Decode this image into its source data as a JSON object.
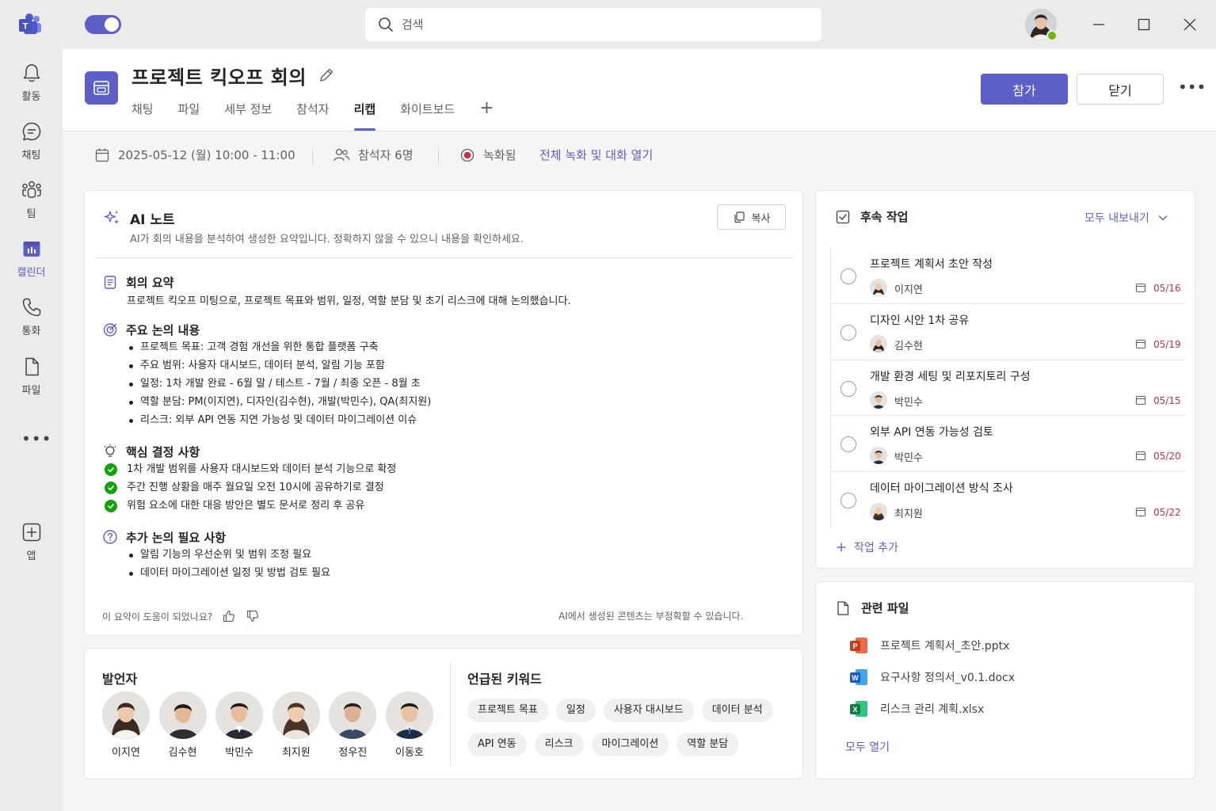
{
  "app": {
    "search_placeholder": "검색",
    "accent": "#5b5fc7"
  },
  "rail": {
    "items": [
      {
        "label": "활동",
        "icon": "bell-icon"
      },
      {
        "label": "채팅",
        "icon": "chat-icon"
      },
      {
        "label": "팀",
        "icon": "teams-icon"
      },
      {
        "label": "캘린더",
        "icon": "calendar-icon"
      },
      {
        "label": "통화",
        "icon": "phone-icon"
      },
      {
        "label": "파일",
        "icon": "file-icon"
      },
      {
        "label": "앱",
        "icon": "add-app-icon"
      }
    ],
    "more": "•••"
  },
  "header": {
    "title": "프로젝트 킥오프 회의",
    "tabs": [
      "채팅",
      "파일",
      "세부 정보",
      "참석자",
      "리캡",
      "화이트보드"
    ],
    "active_tab": "리캡",
    "tab_add": "+",
    "join_label": "참가",
    "close_label": "닫기",
    "more": "•••"
  },
  "info": {
    "datetime": "2025-05-12 (월) 10:00 - 11:00",
    "attendees": "참석자 6명",
    "recorded": "녹화됨",
    "open_link": "전체 녹화 및 대화 열기"
  },
  "ai_note": {
    "title": "AI 노트",
    "subtitle": "AI가 회의 내용을 분석하여 생성한 요약입니다.  정확하지 않을 수 있으니 내용을 확인하세요.",
    "copy_label": "복사",
    "summary_title": "회의 요약",
    "summary_text": "프로젝트 킥오프 미팅으로, 프로젝트 목표와 범위, 일정, 역할 분담 및 초기 리스크에 대해 논의했습니다.",
    "discussion_title": "주요 논의 내용",
    "discussion": [
      "프로젝트 목표: 고객 경험 개선을 위한 통합 플랫폼 구축",
      "주요 범위:  사용자 대시보드, 데이터 분석, 알림 기능 포함",
      "일정:  1차 개발 완료 - 6월 말 /  테스트 - 7월 /  최종 오픈 - 8월 초",
      "역할 분담:  PM(이지연),  디자인(김수현),  개발(박민수),  QA(최지원)",
      "리스크:  외부 API 연동 지연 가능성 및 데이터 마이그레이션 이슈"
    ],
    "decisions_title": "핵심 결정 사항",
    "decisions": [
      "1차 개발 범위를 사용자 대시보드와 데이터 분석 기능으로 확정",
      "주간 진행 상황을 매주 월요일 오전 10시에 공유하기로 결정",
      "위험 요소에 대한 대응 방안은 별도 문서로 정리 후 공유"
    ],
    "followup_title": "추가 논의 필요 사항",
    "followups": [
      "알림 기능의 우선순위 및 범위 조정 필요",
      "데이터 마이그레이션 일정 및 방법 검토 필요"
    ],
    "feedback_q": "이 요약이 도움이 되었나요?",
    "disclaimer": "AI에서 생성된 콘텐츠는 부정확할 수 있습니다."
  },
  "speakers": {
    "title": "발언자",
    "people": [
      "이지연",
      "김수현",
      "박민수",
      "최지원",
      "정우진",
      "이동호"
    ]
  },
  "keywords": {
    "title": "언급된 키워드",
    "row1": [
      "프로젝트 목표",
      "일정",
      "사용자 대시보드",
      "데이터 분석"
    ],
    "row2": [
      "API 연동",
      "리스크",
      "마이그레이션",
      "역할 분담"
    ]
  },
  "tasks": {
    "title": "후속 작업",
    "export_label": "모두 내보내기",
    "add_label": "작업 추가",
    "items": [
      {
        "name": "프로젝트 계획서 초안 작성",
        "owner": "이지연",
        "due": "05/16"
      },
      {
        "name": "디자인 시안 1차 공유",
        "owner": "김수현",
        "due": "05/19"
      },
      {
        "name": "개발 환경 세팅 및 리포지토리 구성",
        "owner": "박민수",
        "due": "05/15"
      },
      {
        "name": "외부 API 연동 가능성 검토",
        "owner": "박민수",
        "due": "05/20"
      },
      {
        "name": "데이터 마이그레이션 방식 조사",
        "owner": "최지원",
        "due": "05/22"
      }
    ]
  },
  "files": {
    "title": "관련 파일",
    "items": [
      {
        "name": "프로젝트 계획서_초안.pptx",
        "type": "powerpoint",
        "color": "#c43e1c",
        "letter": "P"
      },
      {
        "name": "요구사항 정의서_v0.1.docx",
        "type": "word",
        "color": "#185abd",
        "letter": "W"
      },
      {
        "name": "리스크 관리 계획.xlsx",
        "type": "excel",
        "color": "#107c41",
        "letter": "X"
      }
    ],
    "open_all": "모두 열기"
  }
}
